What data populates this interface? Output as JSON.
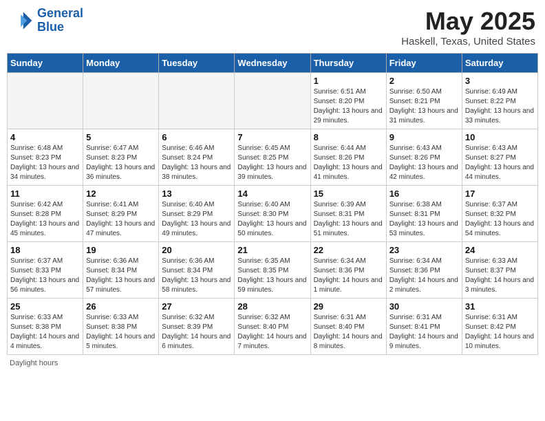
{
  "logo": {
    "line1": "General",
    "line2": "Blue"
  },
  "title": "May 2025",
  "subtitle": "Haskell, Texas, United States",
  "days_of_week": [
    "Sunday",
    "Monday",
    "Tuesday",
    "Wednesday",
    "Thursday",
    "Friday",
    "Saturday"
  ],
  "footer": "Daylight hours",
  "weeks": [
    [
      {
        "num": "",
        "info": ""
      },
      {
        "num": "",
        "info": ""
      },
      {
        "num": "",
        "info": ""
      },
      {
        "num": "",
        "info": ""
      },
      {
        "num": "1",
        "info": "Sunrise: 6:51 AM\nSunset: 8:20 PM\nDaylight: 13 hours and 29 minutes."
      },
      {
        "num": "2",
        "info": "Sunrise: 6:50 AM\nSunset: 8:21 PM\nDaylight: 13 hours and 31 minutes."
      },
      {
        "num": "3",
        "info": "Sunrise: 6:49 AM\nSunset: 8:22 PM\nDaylight: 13 hours and 33 minutes."
      }
    ],
    [
      {
        "num": "4",
        "info": "Sunrise: 6:48 AM\nSunset: 8:23 PM\nDaylight: 13 hours and 34 minutes."
      },
      {
        "num": "5",
        "info": "Sunrise: 6:47 AM\nSunset: 8:23 PM\nDaylight: 13 hours and 36 minutes."
      },
      {
        "num": "6",
        "info": "Sunrise: 6:46 AM\nSunset: 8:24 PM\nDaylight: 13 hours and 38 minutes."
      },
      {
        "num": "7",
        "info": "Sunrise: 6:45 AM\nSunset: 8:25 PM\nDaylight: 13 hours and 39 minutes."
      },
      {
        "num": "8",
        "info": "Sunrise: 6:44 AM\nSunset: 8:26 PM\nDaylight: 13 hours and 41 minutes."
      },
      {
        "num": "9",
        "info": "Sunrise: 6:43 AM\nSunset: 8:26 PM\nDaylight: 13 hours and 42 minutes."
      },
      {
        "num": "10",
        "info": "Sunrise: 6:43 AM\nSunset: 8:27 PM\nDaylight: 13 hours and 44 minutes."
      }
    ],
    [
      {
        "num": "11",
        "info": "Sunrise: 6:42 AM\nSunset: 8:28 PM\nDaylight: 13 hours and 45 minutes."
      },
      {
        "num": "12",
        "info": "Sunrise: 6:41 AM\nSunset: 8:29 PM\nDaylight: 13 hours and 47 minutes."
      },
      {
        "num": "13",
        "info": "Sunrise: 6:40 AM\nSunset: 8:29 PM\nDaylight: 13 hours and 49 minutes."
      },
      {
        "num": "14",
        "info": "Sunrise: 6:40 AM\nSunset: 8:30 PM\nDaylight: 13 hours and 50 minutes."
      },
      {
        "num": "15",
        "info": "Sunrise: 6:39 AM\nSunset: 8:31 PM\nDaylight: 13 hours and 51 minutes."
      },
      {
        "num": "16",
        "info": "Sunrise: 6:38 AM\nSunset: 8:31 PM\nDaylight: 13 hours and 53 minutes."
      },
      {
        "num": "17",
        "info": "Sunrise: 6:37 AM\nSunset: 8:32 PM\nDaylight: 13 hours and 54 minutes."
      }
    ],
    [
      {
        "num": "18",
        "info": "Sunrise: 6:37 AM\nSunset: 8:33 PM\nDaylight: 13 hours and 56 minutes."
      },
      {
        "num": "19",
        "info": "Sunrise: 6:36 AM\nSunset: 8:34 PM\nDaylight: 13 hours and 57 minutes."
      },
      {
        "num": "20",
        "info": "Sunrise: 6:36 AM\nSunset: 8:34 PM\nDaylight: 13 hours and 58 minutes."
      },
      {
        "num": "21",
        "info": "Sunrise: 6:35 AM\nSunset: 8:35 PM\nDaylight: 13 hours and 59 minutes."
      },
      {
        "num": "22",
        "info": "Sunrise: 6:34 AM\nSunset: 8:36 PM\nDaylight: 14 hours and 1 minute."
      },
      {
        "num": "23",
        "info": "Sunrise: 6:34 AM\nSunset: 8:36 PM\nDaylight: 14 hours and 2 minutes."
      },
      {
        "num": "24",
        "info": "Sunrise: 6:33 AM\nSunset: 8:37 PM\nDaylight: 14 hours and 3 minutes."
      }
    ],
    [
      {
        "num": "25",
        "info": "Sunrise: 6:33 AM\nSunset: 8:38 PM\nDaylight: 14 hours and 4 minutes."
      },
      {
        "num": "26",
        "info": "Sunrise: 6:33 AM\nSunset: 8:38 PM\nDaylight: 14 hours and 5 minutes."
      },
      {
        "num": "27",
        "info": "Sunrise: 6:32 AM\nSunset: 8:39 PM\nDaylight: 14 hours and 6 minutes."
      },
      {
        "num": "28",
        "info": "Sunrise: 6:32 AM\nSunset: 8:40 PM\nDaylight: 14 hours and 7 minutes."
      },
      {
        "num": "29",
        "info": "Sunrise: 6:31 AM\nSunset: 8:40 PM\nDaylight: 14 hours and 8 minutes."
      },
      {
        "num": "30",
        "info": "Sunrise: 6:31 AM\nSunset: 8:41 PM\nDaylight: 14 hours and 9 minutes."
      },
      {
        "num": "31",
        "info": "Sunrise: 6:31 AM\nSunset: 8:42 PM\nDaylight: 14 hours and 10 minutes."
      }
    ]
  ]
}
